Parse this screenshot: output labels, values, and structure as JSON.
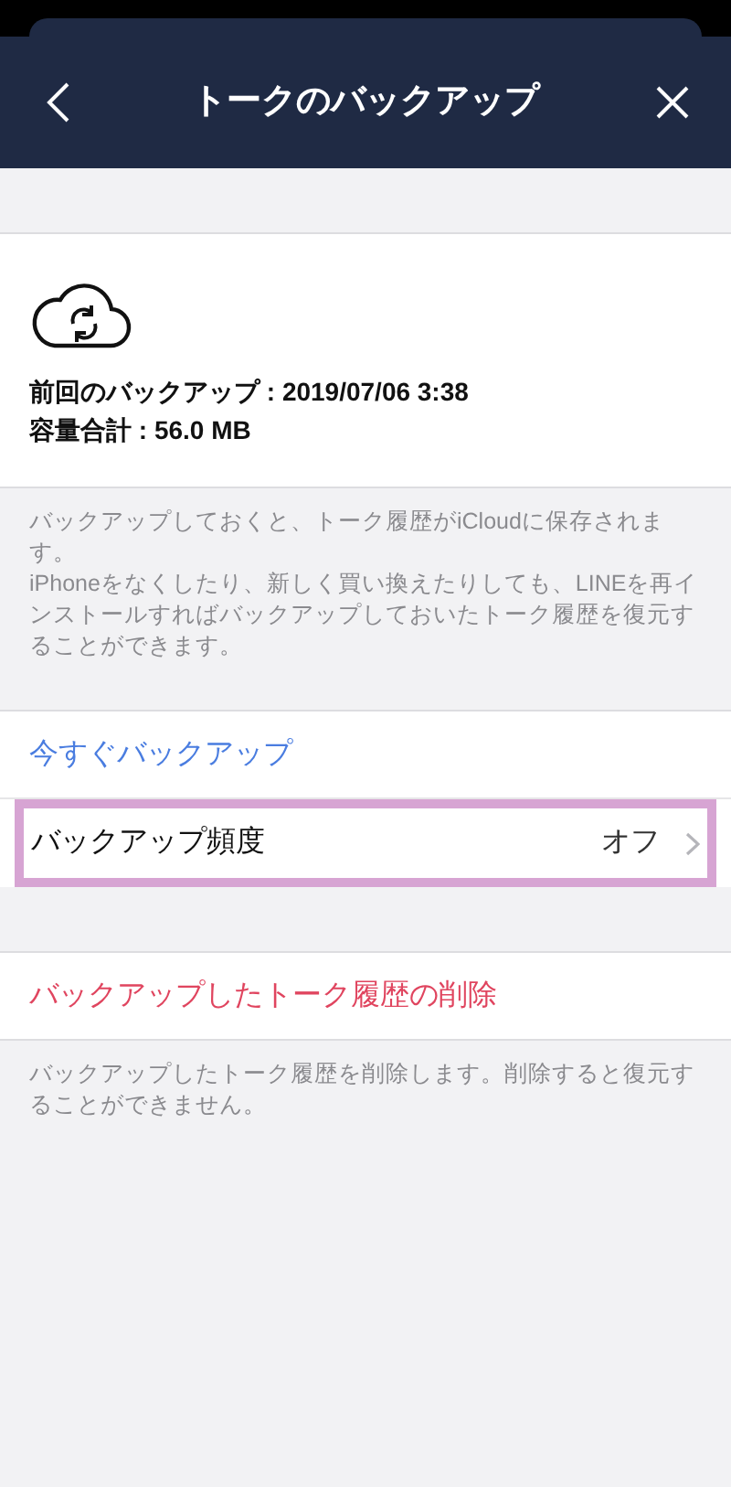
{
  "header": {
    "title": "トークのバックアップ"
  },
  "backup_info": {
    "last_backup": "前回のバックアップ : 2019/07/06 3:38",
    "total_size": "容量合計 : 56.0 MB"
  },
  "info_note": [
    "バックアップしておくと、トーク履歴がiCloudに保存されます。",
    "iPhoneをなくしたり、新しく買い換えたりしても、LINEを再インストールすればバックアップしておいたトーク履歴を復元することができます。"
  ],
  "backup_now": {
    "label": "今すぐバックアップ"
  },
  "frequency_row": {
    "label": "バックアップ頻度",
    "value": "オフ",
    "highlighted": true
  },
  "delete_row": {
    "label": "バックアップしたトーク履歴の削除"
  },
  "delete_note": "バックアップしたトーク履歴を削除します。削除すると復元することができません。"
}
